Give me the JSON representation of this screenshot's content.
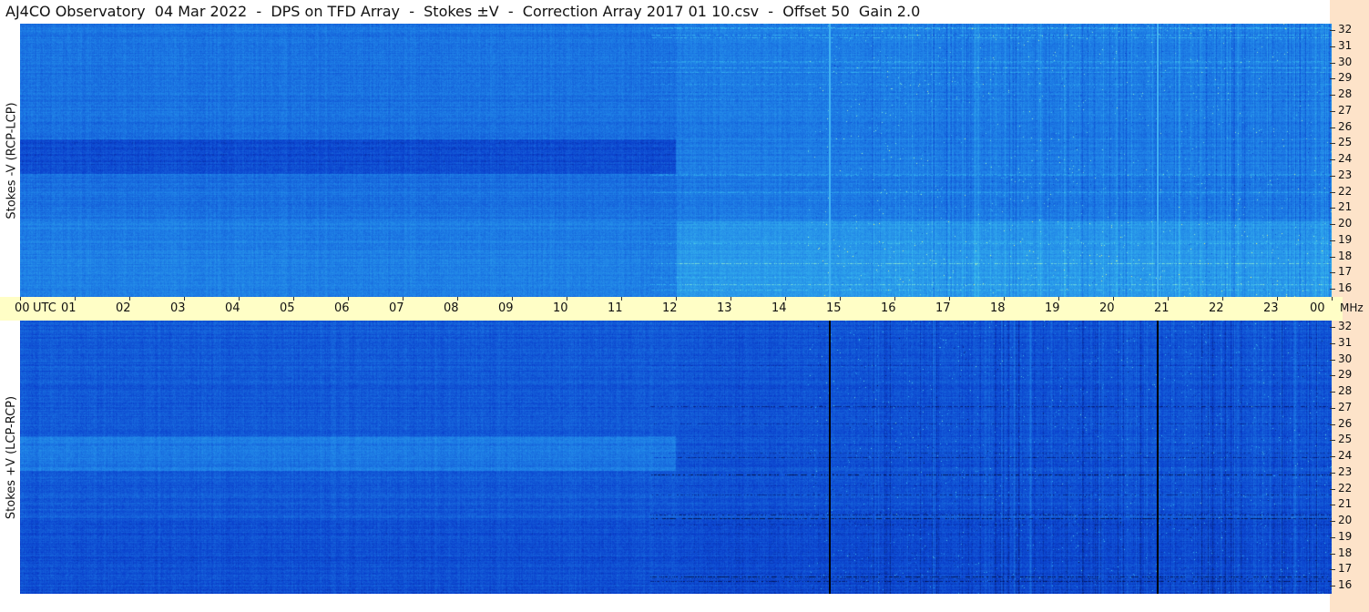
{
  "title": "AJ4CO Observatory  04 Mar 2022  -  DPS on TFD Array  -  Stokes ±V  -  Correction Array 2017 01 10.csv  -  Offset 50  Gain 2.0",
  "colors": {
    "background_strip": "#fde3c9",
    "time_axis": "#fffec6",
    "colormap": [
      "#02104a",
      "#0a3fcc",
      "#1e7fe6",
      "#36b6ee",
      "#9ef0c8",
      "#ffff66"
    ]
  },
  "chart_data": [
    {
      "type": "heatmap",
      "ylabel": "Stokes -V (RCP-LCP)",
      "x_ticks": [
        "00",
        "UTC",
        "01",
        "02",
        "03",
        "04",
        "05",
        "06",
        "07",
        "08",
        "09",
        "10",
        "11",
        "12",
        "13",
        "14",
        "15",
        "16",
        "17",
        "18",
        "19",
        "20",
        "21",
        "22",
        "23",
        "00"
      ],
      "x_range_utc_hours": [
        0,
        24
      ],
      "y_ticks": [
        "16",
        "17",
        "18",
        "19",
        "20",
        "21",
        "22",
        "23",
        "24",
        "25",
        "26",
        "27",
        "28",
        "29",
        "30",
        "31",
        "32"
      ],
      "y_range_mhz": [
        16,
        32
      ],
      "y_unit": "MHz",
      "vertical_lines_utc": [
        14.8,
        20.8
      ],
      "vertical_line_color": "#3fb0f0"
    },
    {
      "type": "heatmap",
      "ylabel": "Stokes +V (LCP-RCP)",
      "x_range_utc_hours": [
        0,
        24
      ],
      "y_ticks": [
        "16",
        "17",
        "18",
        "19",
        "20",
        "21",
        "22",
        "23",
        "24",
        "25",
        "26",
        "27",
        "28",
        "29",
        "30",
        "31",
        "32"
      ],
      "y_range_mhz": [
        16,
        32
      ],
      "vertical_lines_utc": [
        14.8,
        20.8
      ],
      "vertical_line_color": "#000000"
    }
  ],
  "labels": {
    "top_ylabel": "Stokes -V (RCP-LCP)",
    "bottom_ylabel": "Stokes +V (LCP-RCP)",
    "utc_label": "UTC",
    "mhz_label": "MHz"
  }
}
